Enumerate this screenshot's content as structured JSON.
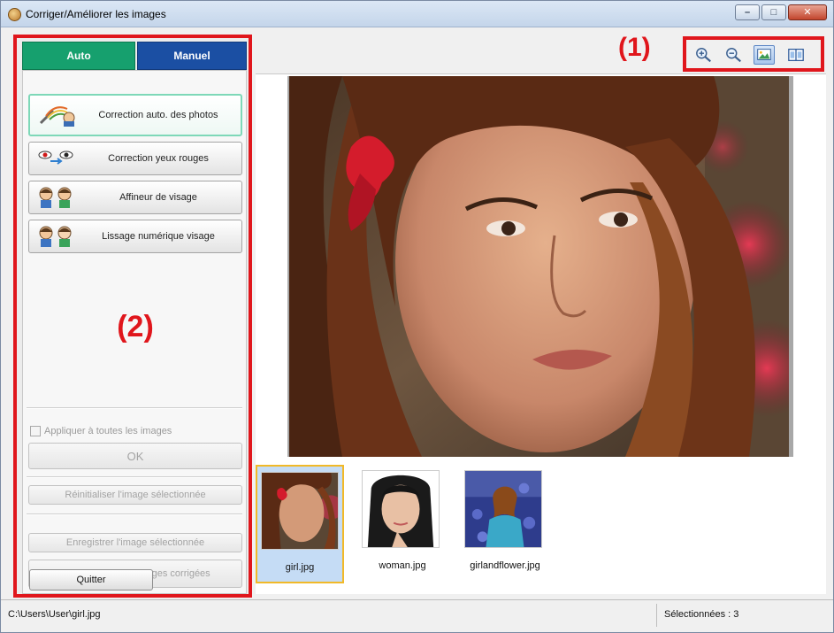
{
  "window": {
    "title": "Corriger/Améliorer les images"
  },
  "tabs": [
    {
      "label": "Auto"
    },
    {
      "label": "Manuel"
    }
  ],
  "features": [
    {
      "label": "Correction auto. des photos",
      "icon": "auto-photo-fix-icon"
    },
    {
      "label": "Correction yeux rouges",
      "icon": "red-eye-icon"
    },
    {
      "label": "Affineur de visage",
      "icon": "face-sharpener-icon"
    },
    {
      "label": "Lissage numérique visage",
      "icon": "face-smoothing-icon"
    }
  ],
  "annotations": {
    "left_panel": "(2)",
    "toolbar": "(1)"
  },
  "options": {
    "apply_all_label": "Appliquer à toutes les images",
    "apply_all_checked": false
  },
  "buttons": {
    "ok": "OK",
    "reset": "Réinitialiser l'image sélectionnée",
    "save_selected": "Enregistrer l'image sélectionnée",
    "save_all": "Enreg. toutes les images corrigées",
    "quit": "Quitter"
  },
  "toolbar": {
    "items": [
      {
        "icon": "zoom-in-icon"
      },
      {
        "icon": "zoom-out-icon"
      },
      {
        "icon": "whole-image-icon",
        "active": true
      },
      {
        "icon": "compare-icon"
      }
    ]
  },
  "thumbnails": [
    {
      "name": "girl.jpg",
      "selected": true
    },
    {
      "name": "woman.jpg",
      "selected": false
    },
    {
      "name": "girlandflower.jpg",
      "selected": false
    }
  ],
  "status": {
    "path": "C:\\Users\\User\\girl.jpg",
    "selected": "Sélectionnées : 3"
  },
  "colors": {
    "highlight_red": "#e0161c",
    "auto_tab": "#16a06e",
    "manuel_tab": "#1b4fa3"
  }
}
